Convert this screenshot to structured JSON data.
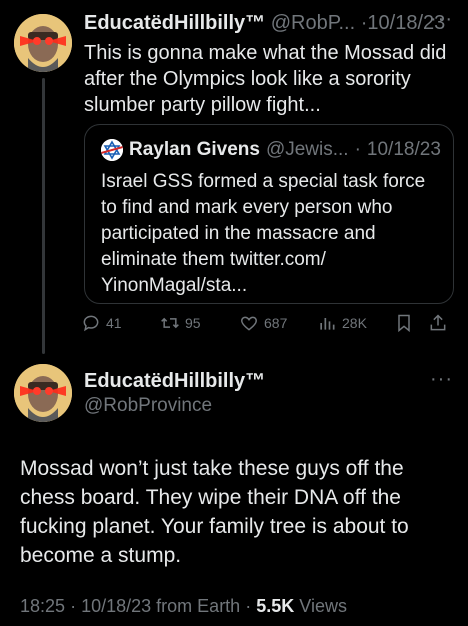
{
  "tweet1": {
    "name": "EducatëdHillbilly™",
    "handle": "@RobP...",
    "dot": "·",
    "date": "10/18/23",
    "more": "···",
    "text": "This is gonna make what the Mossad did after the Olympics look like a sorority slumber party pillow fight...",
    "quote": {
      "name": "Raylan Givens",
      "handle": "@Jewis...",
      "dot": "·",
      "date": "10/18/23",
      "text": "Israel GSS formed a special task force to find and mark every person who participated in the massacre and eliminate them twitter.com/ YinonMagal/sta..."
    },
    "actions": {
      "replies": "41",
      "retweets": "95",
      "likes": "687",
      "views": "28K"
    }
  },
  "tweet2": {
    "name": "EducatëdHillbilly™",
    "handle": "@RobProvince",
    "more": "···",
    "text": "Mossad won’t just take these guys off the chess board. They wipe their DNA off the fucking planet. Your family tree is about to become a stump.",
    "time": "18:25",
    "dot1": "·",
    "date": "10/18/23",
    "from": "from Earth",
    "dot2": "·",
    "views_count": "5.5K",
    "views_label": "Views"
  },
  "colors": {
    "background": "#000000",
    "text": "#e7e9ea",
    "muted": "#71767b",
    "border": "#2f3336",
    "avatar_bg": "#e7c070",
    "laser_eyes": "#ff2a1a"
  },
  "icons": [
    "reply-icon",
    "retweet-icon",
    "like-icon",
    "views-icon",
    "bookmark-icon",
    "share-icon",
    "star-of-david-icon"
  ]
}
